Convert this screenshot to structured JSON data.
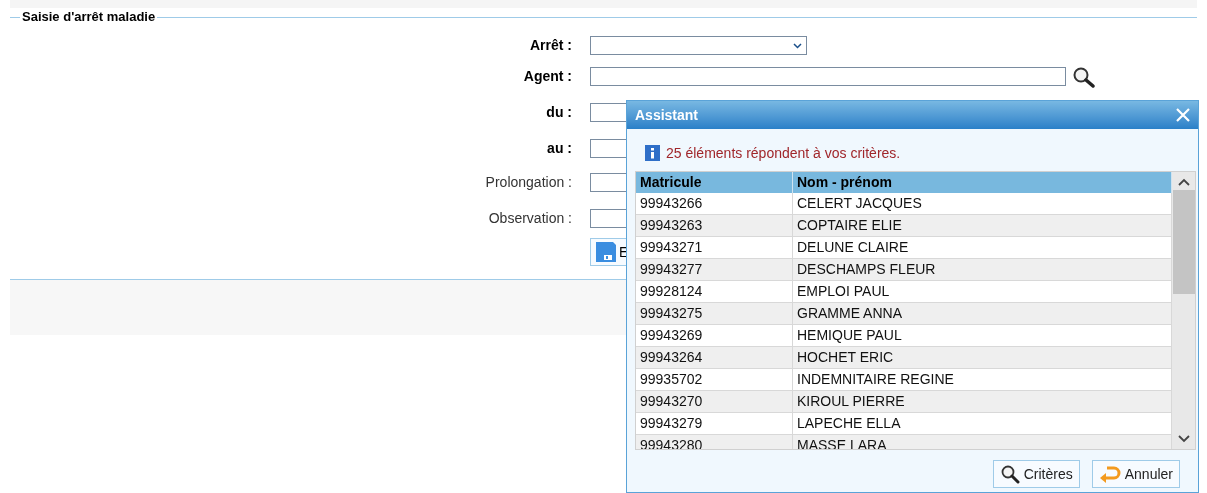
{
  "form": {
    "legend": "Saisie d'arrêt maladie",
    "fields": [
      {
        "kind": "select",
        "label": "Arrêt :",
        "bold": true
      },
      {
        "kind": "search",
        "label": "Agent :",
        "bold": true
      },
      {
        "kind": "input",
        "label": "du :",
        "bold": true
      },
      {
        "kind": "input",
        "label": "au :",
        "bold": true
      },
      {
        "kind": "input",
        "label": "Prolongation :",
        "bold": false
      },
      {
        "kind": "input",
        "label": "Observation :",
        "bold": false
      }
    ],
    "save_button": "E"
  },
  "dialog": {
    "title": "Assistant",
    "message": "25 éléments répondent à vos critères.",
    "table": {
      "columns": [
        "Matricule",
        "Nom - prénom"
      ],
      "rows": [
        [
          "99943266",
          "CELERT JACQUES"
        ],
        [
          "99943263",
          "COPTAIRE ELIE"
        ],
        [
          "99943271",
          "DELUNE CLAIRE"
        ],
        [
          "99943277",
          "DESCHAMPS FLEUR"
        ],
        [
          "99928124",
          "EMPLOI PAUL"
        ],
        [
          "99943275",
          "GRAMME ANNA"
        ],
        [
          "99943269",
          "HEMIQUE PAUL"
        ],
        [
          "99943264",
          "HOCHET ERIC"
        ],
        [
          "99935702",
          "INDEMNITAIRE REGINE"
        ],
        [
          "99943270",
          "KIROUL PIERRE"
        ],
        [
          "99943279",
          "LAPECHE ELLA"
        ],
        [
          "99943280",
          "MASSE LARA"
        ]
      ]
    },
    "buttons": [
      {
        "kind": "search",
        "label": "Critères"
      },
      {
        "kind": "cancel",
        "label": "Annuler"
      }
    ]
  }
}
